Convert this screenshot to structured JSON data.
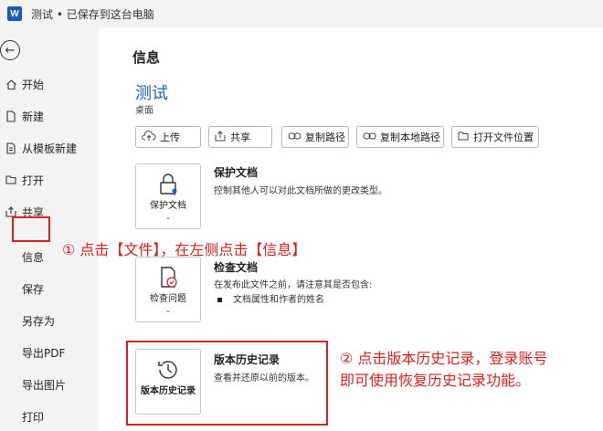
{
  "titlebar": {
    "logo": "W",
    "title": "测试 • 已保存到这台电脑"
  },
  "sidebar": {
    "back_icon": "arrow-left-icon",
    "items": [
      {
        "label": "开始",
        "icon": "home-icon"
      },
      {
        "label": "新建",
        "icon": "new-document-icon"
      },
      {
        "label": "从模板新建",
        "icon": "template-icon"
      },
      {
        "label": "打开",
        "icon": "folder-open-icon"
      },
      {
        "label": "共享",
        "icon": "share-icon"
      },
      {
        "label": "信息"
      },
      {
        "label": "保存"
      },
      {
        "label": "另存为"
      },
      {
        "label": "导出PDF"
      },
      {
        "label": "导出图片"
      },
      {
        "label": "打印"
      }
    ]
  },
  "main": {
    "title": "信息",
    "doc_name": "测试",
    "doc_location": "桌面",
    "actions": [
      {
        "label": "上传",
        "icon": "cloud-upload-icon"
      },
      {
        "label": "共享",
        "icon": "share-icon"
      },
      {
        "label": "复制路径",
        "icon": "link-icon"
      },
      {
        "label": "复制本地路径",
        "icon": "link-icon"
      },
      {
        "label": "打开文件位置",
        "icon": "folder-icon"
      }
    ],
    "sections": {
      "protect": {
        "card_label": "保护文档",
        "title": "保护文档",
        "desc": "控制其他人可以对此文档所做的更改类型。"
      },
      "inspect": {
        "card_label": "检查问题",
        "title": "检查文档",
        "desc": "在发布此文件之前，请注意其是否包含:",
        "bullets": [
          "文档属性和作者的姓名"
        ]
      },
      "history": {
        "card_label": "版本历史记录",
        "title": "版本历史记录",
        "desc": "查看并还原以前的版本。"
      }
    }
  },
  "annotations": {
    "step1": "① 点击【文件】，在左侧点击【信息】",
    "step2_line1": "② 点击版本历史记录，登录账号",
    "step2_line2": "即可使用恢复历史记录功能。"
  },
  "colors": {
    "accent": "#1f5fb0",
    "annotation": "#e02020",
    "word_brand": "#185abd"
  }
}
